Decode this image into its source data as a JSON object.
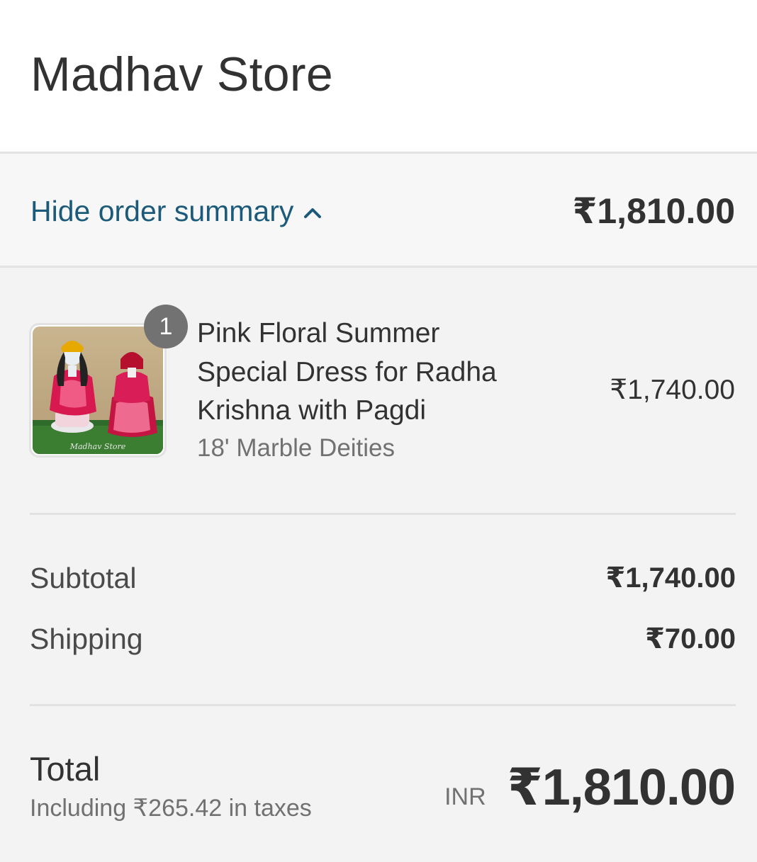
{
  "store": {
    "name": "Madhav Store"
  },
  "summary_toggle": {
    "label": "Hide order summary",
    "icon": "chevron-up-icon",
    "total": "₹1,810.00"
  },
  "line_items": [
    {
      "quantity": "1",
      "title": "Pink Floral Summer Special Dress for Radha Krishna with Pagdi",
      "variant": "18' Marble Deities",
      "price": "₹1,740.00",
      "thumbnail_watermark": "Madhav Store"
    }
  ],
  "costs": {
    "subtotal_label": "Subtotal",
    "subtotal_value": "₹1,740.00",
    "shipping_label": "Shipping",
    "shipping_value": "₹70.00"
  },
  "total": {
    "label": "Total",
    "tax_note": "Including ₹265.42 in taxes",
    "currency": "INR",
    "amount": "₹1,810.00"
  },
  "colors": {
    "link": "#1c5a7a",
    "badge": "#727272",
    "panel_background": "#f3f3f3"
  }
}
